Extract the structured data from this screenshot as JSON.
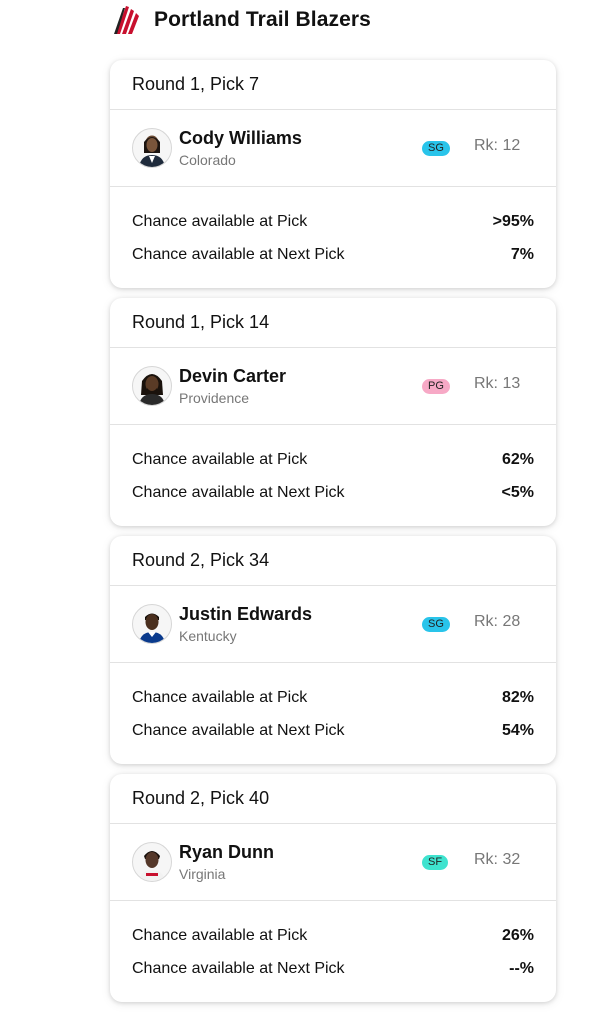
{
  "header": {
    "team_name": "Portland Trail Blazers",
    "logo_icon": "trail-blazers-pinwheel-icon",
    "logo_color": "#c8102e"
  },
  "labels": {
    "chance_at_pick": "Chance available at Pick",
    "chance_at_next_pick": "Chance available at Next Pick"
  },
  "picks": [
    {
      "title": "Round 1, Pick 7",
      "player": "Cody Williams",
      "school": "Colorado",
      "position": "SG",
      "position_color": "#29c4ea",
      "rank": "Rk: 12",
      "chance_at_pick": ">95%",
      "chance_at_next_pick": "7%"
    },
    {
      "title": "Round 1, Pick 14",
      "player": "Devin Carter",
      "school": "Providence",
      "position": "PG",
      "position_color": "#f7a9c6",
      "rank": "Rk: 13",
      "chance_at_pick": "62%",
      "chance_at_next_pick": "<5%"
    },
    {
      "title": "Round 2, Pick 34",
      "player": "Justin Edwards",
      "school": "Kentucky",
      "position": "SG",
      "position_color": "#29c4ea",
      "rank": "Rk: 28",
      "chance_at_pick": "82%",
      "chance_at_next_pick": "54%"
    },
    {
      "title": "Round 2, Pick 40",
      "player": "Ryan Dunn",
      "school": "Virginia",
      "position": "SF",
      "position_color": "#3fe3cf",
      "rank": "Rk: 32",
      "chance_at_pick": "26%",
      "chance_at_next_pick": "--%"
    }
  ]
}
